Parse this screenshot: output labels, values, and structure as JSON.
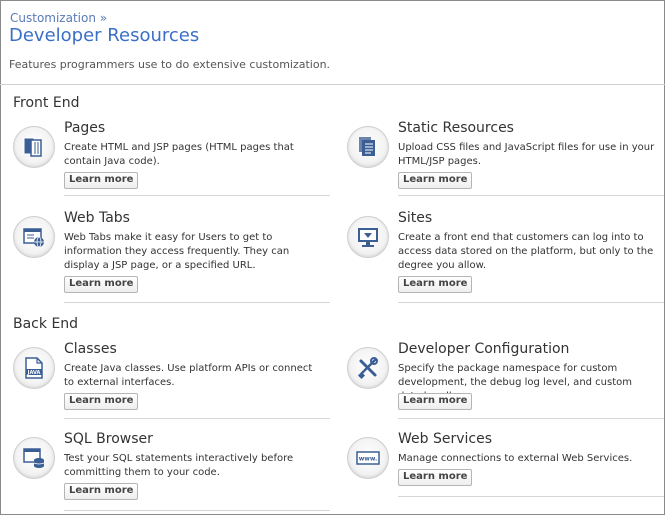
{
  "breadcrumb": "Customization »",
  "page_title": "Developer Resources",
  "subtitle": "Features programmers use to do extensive customization.",
  "learn_more": "Learn more",
  "sections": {
    "front_end": {
      "title": "Front End",
      "items": [
        {
          "title": "Pages",
          "desc": "Create HTML and JSP pages (HTML pages that contain Java code).",
          "icon": "pages-icon"
        },
        {
          "title": "Static Resources",
          "desc": "Upload CSS files and JavaScript files for use in your HTML/JSP pages.",
          "icon": "static-resources-icon"
        },
        {
          "title": "Web Tabs",
          "desc": "Web Tabs make it easy for Users to get to information they access frequently. They can display a JSP page, or a specified URL.",
          "icon": "web-tabs-icon"
        },
        {
          "title": "Sites",
          "desc": "Create a front end that customers can log into to access data stored on the platform, but only to the degree you allow.",
          "icon": "sites-icon"
        }
      ]
    },
    "back_end": {
      "title": "Back End",
      "items": [
        {
          "title": "Classes",
          "desc": "Create Java classes. Use platform APIs or connect to external interfaces.",
          "icon": "java-file-icon",
          "icon_label": "JAVA"
        },
        {
          "title": "Developer Configuration",
          "desc": "Specify the package namespace for custom development, the debug log level, and custom data handlers.",
          "icon": "tools-icon"
        },
        {
          "title": "SQL Browser",
          "desc": "Test your SQL statements interactively before committing them to your code.",
          "icon": "sql-database-icon"
        },
        {
          "title": "Web Services",
          "desc": "Manage connections to external Web Services.",
          "icon": "web-services-icon",
          "icon_label": "www."
        }
      ]
    }
  },
  "colors": {
    "accent": "#3a6fc8",
    "breadcrumb": "#5a7bb8",
    "icon_blue": "#3b5f95"
  }
}
